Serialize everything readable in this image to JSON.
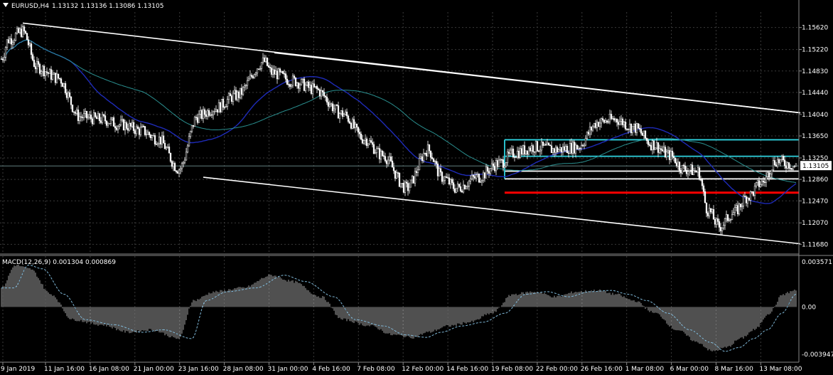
{
  "header": {
    "symbol": "EURUSD,H4",
    "ohlc": "1.13132 1.13136 1.13086 1.13105"
  },
  "macd": {
    "title": "MACD(12,26,9) 0.001304 0.000869",
    "ticks": [
      "0.003571",
      "0.00",
      "-0.003947"
    ]
  },
  "price_axis": {
    "ticks": [
      "1.15620",
      "1.15220",
      "1.14830",
      "1.14440",
      "1.14040",
      "1.13650",
      "1.13250",
      "1.12860",
      "1.12470",
      "1.12070",
      "1.11680"
    ],
    "current_price": "1.13105"
  },
  "time_axis": [
    "9 Jan 2019",
    "11 Jan 16:00",
    "16 Jan 08:00",
    "21 Jan 00:00",
    "23 Jan 16:00",
    "28 Jan 08:00",
    "31 Jan 00:00",
    "4 Feb 16:00",
    "7 Feb 08:00",
    "12 Feb 00:00",
    "14 Feb 16:00",
    "19 Feb 08:00",
    "22 Feb 00:00",
    "26 Feb 16:00",
    "1 Mar 08:00",
    "6 Mar 00:00",
    "8 Mar 16:00",
    "13 Mar 08:00"
  ],
  "colors": {
    "background": "#000000",
    "bull": "#ffffff",
    "bear": "#ffffff",
    "ma_fast": "#1e2bb8",
    "ma_slow": "#2a8f8f",
    "channel": "#ffffff",
    "support": "#ff0000",
    "zone": "#2fd3e0",
    "macd_hist": "#c8c8c8",
    "macd_signal": "#7fb8d8"
  },
  "chart_data": {
    "type": "candlestick",
    "ylim": [
      1.1153,
      1.159
    ],
    "macd_ylim": [
      -0.0043,
      0.004
    ],
    "anchors": [
      [
        0,
        1.1505
      ],
      [
        5,
        1.154
      ],
      [
        15,
        1.1555
      ],
      [
        25,
        1.149
      ],
      [
        40,
        1.147
      ],
      [
        55,
        1.14
      ],
      [
        70,
        1.1395
      ],
      [
        85,
        1.1385
      ],
      [
        98,
        1.1375
      ],
      [
        110,
        1.136
      ],
      [
        125,
        1.1305
      ],
      [
        138,
        1.14
      ],
      [
        150,
        1.1415
      ],
      [
        165,
        1.1438
      ],
      [
        185,
        1.15
      ],
      [
        190,
        1.148
      ],
      [
        205,
        1.1465
      ],
      [
        220,
        1.145
      ],
      [
        240,
        1.1405
      ],
      [
        255,
        1.136
      ],
      [
        268,
        1.133
      ],
      [
        285,
        1.127
      ],
      [
        300,
        1.134
      ],
      [
        310,
        1.129
      ],
      [
        320,
        1.127
      ],
      [
        335,
        1.129
      ],
      [
        350,
        1.1315
      ],
      [
        362,
        1.1335
      ],
      [
        375,
        1.1345
      ],
      [
        390,
        1.134
      ],
      [
        405,
        1.1345
      ],
      [
        420,
        1.139
      ],
      [
        432,
        1.1395
      ],
      [
        445,
        1.138
      ],
      [
        458,
        1.135
      ],
      [
        470,
        1.133
      ],
      [
        480,
        1.1305
      ],
      [
        490,
        1.13
      ],
      [
        497,
        1.123
      ],
      [
        505,
        1.12
      ],
      [
        515,
        1.1225
      ],
      [
        525,
        1.1255
      ],
      [
        535,
        1.128
      ],
      [
        545,
        1.132
      ],
      [
        553,
        1.1315
      ],
      [
        558,
        1.131
      ]
    ],
    "macd_anchors": [
      [
        0,
        0.0015
      ],
      [
        10,
        0.0033
      ],
      [
        20,
        0.003
      ],
      [
        35,
        0.001
      ],
      [
        50,
        -0.001
      ],
      [
        70,
        -0.0014
      ],
      [
        90,
        -0.002
      ],
      [
        105,
        -0.0018
      ],
      [
        125,
        -0.0025
      ],
      [
        135,
        0.0005
      ],
      [
        150,
        0.0012
      ],
      [
        170,
        0.0015
      ],
      [
        190,
        0.0025
      ],
      [
        205,
        0.002
      ],
      [
        225,
        0.0008
      ],
      [
        240,
        -0.001
      ],
      [
        260,
        -0.0015
      ],
      [
        275,
        -0.0022
      ],
      [
        290,
        -0.0024
      ],
      [
        300,
        -0.002
      ],
      [
        315,
        -0.0015
      ],
      [
        330,
        -0.0012
      ],
      [
        345,
        -0.0005
      ],
      [
        360,
        0.001
      ],
      [
        375,
        0.0012
      ],
      [
        390,
        0.0008
      ],
      [
        405,
        0.0012
      ],
      [
        420,
        0.0013
      ],
      [
        432,
        0.001
      ],
      [
        445,
        0.0005
      ],
      [
        460,
        -0.0005
      ],
      [
        475,
        -0.0018
      ],
      [
        490,
        -0.0028
      ],
      [
        500,
        -0.0035
      ],
      [
        510,
        -0.0032
      ],
      [
        520,
        -0.0025
      ],
      [
        530,
        -0.0018
      ],
      [
        540,
        -0.0005
      ],
      [
        550,
        0.001
      ],
      [
        558,
        0.0013
      ]
    ],
    "trendlines": [
      {
        "name": "channel-upper",
        "x1": 15,
        "y1": 1.157,
        "x2": 562,
        "y2": 1.1407
      },
      {
        "name": "channel-lower",
        "x1": 142,
        "y1": 1.129,
        "x2": 562,
        "y2": 1.1169
      },
      {
        "name": "channel-mid",
        "x1": 192,
        "y1": 1.1516,
        "x2": 562,
        "y2": 1.1407
      }
    ],
    "levels": [
      {
        "name": "zone-top",
        "price": 1.1358,
        "from": 354,
        "color": "#2fd3e0"
      },
      {
        "name": "zone-bottom",
        "price": 1.1328,
        "from": 354,
        "color": "#2fd3e0"
      },
      {
        "name": "level-mid",
        "price": 1.1301,
        "from": 354,
        "color": "#ffffff"
      },
      {
        "name": "level-low",
        "price": 1.1287,
        "from": 354,
        "color": "#ffffff"
      },
      {
        "name": "support",
        "price": 1.1262,
        "from": 354,
        "color": "#ff0000"
      }
    ]
  }
}
